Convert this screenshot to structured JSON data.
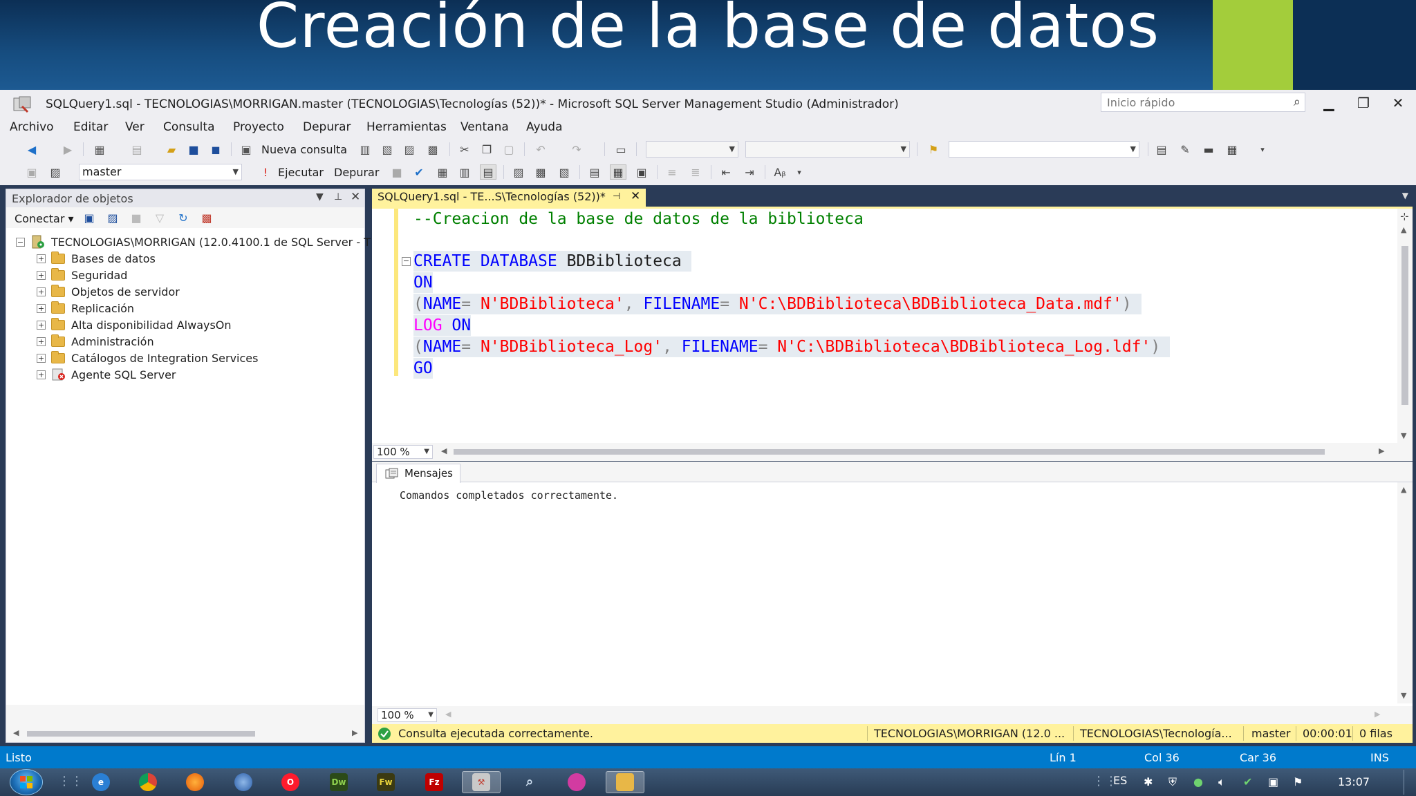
{
  "slide": {
    "title": "Creación de la base de datos"
  },
  "window": {
    "title": "SQLQuery1.sql - TECNOLOGIAS\\MORRIGAN.master (TECNOLOGIAS\\Tecnologías (52))* - Microsoft SQL Server Management Studio (Administrador)",
    "quick_launch_placeholder": "Inicio rápido"
  },
  "menu": [
    "Archivo",
    "Editar",
    "Ver",
    "Consulta",
    "Proyecto",
    "Depurar",
    "Herramientas",
    "Ventana",
    "Ayuda"
  ],
  "toolbar": {
    "new_query_label": "Nueva consulta",
    "database_selected": "master",
    "execute_label": "Ejecutar",
    "debug_label": "Depurar"
  },
  "object_explorer": {
    "title": "Explorador de objetos",
    "connect_label": "Conectar",
    "server_node": "TECNOLOGIAS\\MORRIGAN (12.0.4100.1 de SQL Server - T",
    "nodes": [
      "Bases de datos",
      "Seguridad",
      "Objetos de servidor",
      "Replicación",
      "Alta disponibilidad AlwaysOn",
      "Administración",
      "Catálogos de Integration Services",
      "Agente SQL Server"
    ]
  },
  "editor": {
    "tab_label": "SQLQuery1.sql - TE...S\\Tecnologías (52))*",
    "zoom": "100 %",
    "code": {
      "comment": "--Creacion de la base de datos de la biblioteca",
      "create_kw": "CREATE DATABASE",
      "db_name": "BDBiblioteca",
      "on_kw": "ON",
      "name_kw": "NAME",
      "filename_kw": "FILENAME",
      "data_name": "N'BDBiblioteca'",
      "data_file": "N'C:\\BDBiblioteca\\BDBiblioteca_Data.mdf'",
      "log_kw": "LOG",
      "log_name": "N'BDBiblioteca_Log'",
      "log_file": "N'C:\\BDBiblioteca\\BDBiblioteca_Log.ldf'",
      "go_kw": "GO"
    }
  },
  "results": {
    "tab_label": "Mensajes",
    "message": "Comandos completados correctamente.",
    "zoom": "100 %"
  },
  "query_status": {
    "message": "Consulta ejecutada correctamente.",
    "server": "TECNOLOGIAS\\MORRIGAN (12.0 ...",
    "user": "TECNOLOGIAS\\Tecnología...",
    "database": "master",
    "elapsed": "00:00:01",
    "rows": "0 filas"
  },
  "status_bar": {
    "ready": "Listo",
    "line": "Lín 1",
    "col": "Col 36",
    "char": "Car 36",
    "mode": "INS"
  },
  "taskbar": {
    "language": "ES",
    "time": "13:07"
  },
  "colors": {
    "accent_blue": "#007acc",
    "tab_yellow": "#fff29d",
    "banner_green": "#a3cd3b",
    "keyword": "#0000ff",
    "string": "#ff0000",
    "comment": "#008000"
  }
}
